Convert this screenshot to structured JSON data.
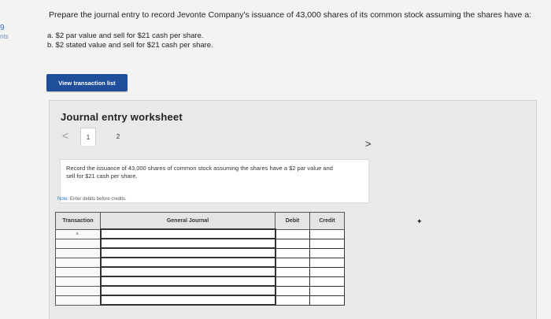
{
  "margin": {
    "score": "9",
    "label": "nts"
  },
  "question": {
    "prompt": "Prepare the journal entry to record Jevonte Company's issuance of 43,000 shares of its common stock assuming the shares have a:",
    "parts": [
      "a.  $2 par value and sell for $21 cash per share.",
      "b.  $2 stated value and sell for $21 cash per share."
    ]
  },
  "view_button_label": "View transaction list",
  "worksheet": {
    "title": "Journal entry worksheet",
    "prev_icon": "<",
    "next_icon": ">",
    "pages": [
      "1",
      "2"
    ],
    "instruction": "Record the issuance of 43,000 shares of common stock assuming the shares have a $2 par value and sell for $21 cash per share.",
    "note_label": "Note:",
    "note_text": " Enter debits before credits."
  },
  "table": {
    "columns": [
      "Transaction",
      "General Journal",
      "Debit",
      "Credit"
    ],
    "rows": [
      {
        "transaction": "a.",
        "account": "",
        "debit": "",
        "credit": ""
      },
      {
        "transaction": "",
        "account": "",
        "debit": "",
        "credit": ""
      },
      {
        "transaction": "",
        "account": "",
        "debit": "",
        "credit": ""
      },
      {
        "transaction": "",
        "account": "",
        "debit": "",
        "credit": ""
      },
      {
        "transaction": "",
        "account": "",
        "debit": "",
        "credit": ""
      },
      {
        "transaction": "",
        "account": "",
        "debit": "",
        "credit": ""
      },
      {
        "transaction": "",
        "account": "",
        "debit": "",
        "credit": ""
      },
      {
        "transaction": "",
        "account": "",
        "debit": "",
        "credit": ""
      }
    ]
  },
  "colors": {
    "button_bg": "#1f4e9a",
    "link_blue": "#2a6ebb",
    "panel_bg": "#e9e9e7"
  }
}
